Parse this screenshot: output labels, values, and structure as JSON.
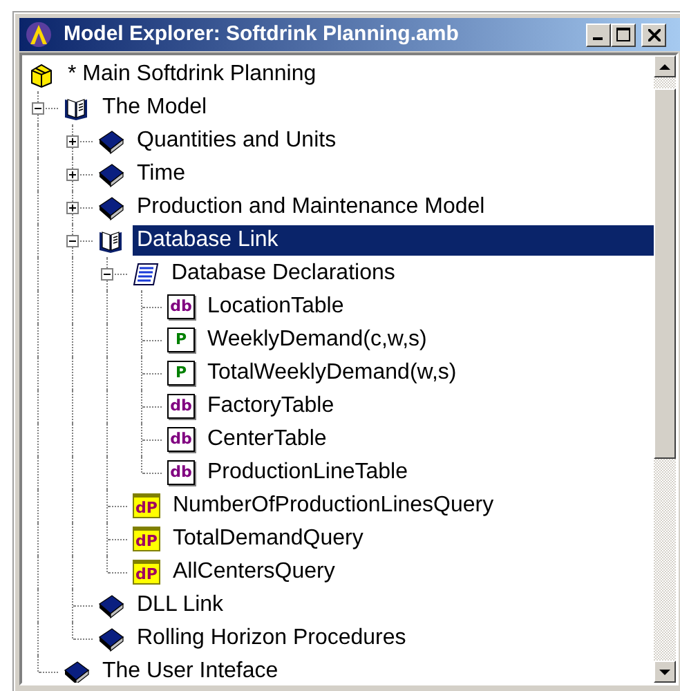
{
  "window": {
    "title": "Model Explorer: Softdrink Planning.amb"
  },
  "tree": {
    "label": "* Main Softdrink Planning",
    "kind": "package",
    "selected": false,
    "children": [
      {
        "label": "The Model",
        "kind": "open-book",
        "expanded": true,
        "selected": false,
        "children": [
          {
            "label": "Quantities and Units",
            "kind": "book",
            "expanded": false,
            "selected": false
          },
          {
            "label": "Time",
            "kind": "book",
            "expanded": false,
            "selected": false
          },
          {
            "label": "Production and Maintenance Model",
            "kind": "book",
            "expanded": false,
            "selected": false
          },
          {
            "label": "Database Link",
            "kind": "open-book",
            "expanded": true,
            "selected": true,
            "children": [
              {
                "label": "Database Declarations",
                "kind": "scroll",
                "expanded": true,
                "selected": false,
                "children": [
                  {
                    "label": "LocationTable",
                    "kind": "table",
                    "icon_label": "db",
                    "selected": false
                  },
                  {
                    "label": "WeeklyDemand(c,w,s)",
                    "kind": "parameter",
                    "icon_label": "P",
                    "selected": false
                  },
                  {
                    "label": "TotalWeeklyDemand(w,s)",
                    "kind": "parameter",
                    "icon_label": "P",
                    "selected": false
                  },
                  {
                    "label": "FactoryTable",
                    "kind": "table",
                    "icon_label": "db",
                    "selected": false
                  },
                  {
                    "label": "CenterTable",
                    "kind": "table",
                    "icon_label": "db",
                    "selected": false
                  },
                  {
                    "label": "ProductionLineTable",
                    "kind": "table",
                    "icon_label": "db",
                    "selected": false
                  }
                ]
              },
              {
                "label": "NumberOfProductionLinesQuery",
                "kind": "query",
                "icon_label": "dP",
                "selected": false
              },
              {
                "label": "TotalDemandQuery",
                "kind": "query",
                "icon_label": "dP",
                "selected": false
              },
              {
                "label": "AllCentersQuery",
                "kind": "query",
                "icon_label": "dP",
                "selected": false
              }
            ]
          },
          {
            "label": "DLL Link",
            "kind": "book",
            "selected": false
          },
          {
            "label": "Rolling Horizon Procedures",
            "kind": "book",
            "selected": false
          }
        ]
      },
      {
        "label": "The User Inteface",
        "kind": "book",
        "selected": false
      }
    ]
  }
}
